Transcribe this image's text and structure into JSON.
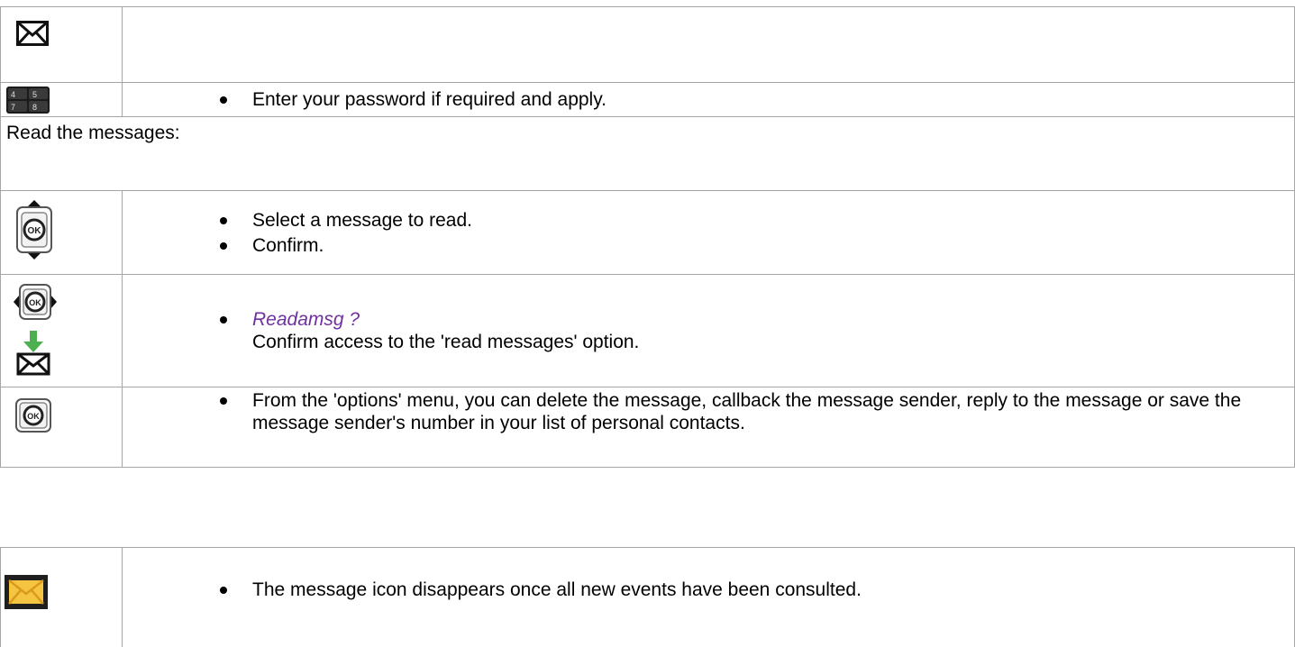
{
  "rows": {
    "password": {
      "text": "Enter your password if required and apply."
    },
    "read_heading": "Read the messages:",
    "select": {
      "item1": "Select a message to read.",
      "item2": "Confirm."
    },
    "readamsg": {
      "label": "Readamsg ?",
      "text": "Confirm access to the 'read messages' option."
    },
    "options": {
      "text": "From the 'options' menu, you can delete the message, callback the message sender, reply to the message or save the message sender's number in your list of personal contacts."
    }
  },
  "bottom": {
    "text": "The message icon disappears once all new events have been consulted."
  },
  "icons": {
    "row1": "envelope-icon",
    "row2": "keypad-icon",
    "row4": "navigator-up-down-ok-icon",
    "row5a": "navigator-left-right-ok-icon",
    "row5b": "envelope-download-icon",
    "row6": "ok-button-icon",
    "bottom": "yellow-envelope-icon"
  },
  "keypad_digits": [
    "4",
    "5",
    "7",
    "8"
  ],
  "ok_label": "OK",
  "colors": {
    "border": "#a6a6a6",
    "italic": "#7030a0",
    "yellow": "#f5c542",
    "green": "#4caf50"
  }
}
